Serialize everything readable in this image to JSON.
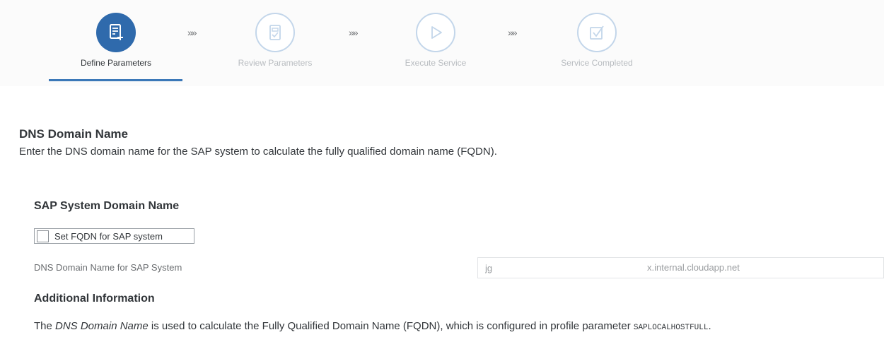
{
  "wizard": {
    "steps": [
      {
        "label": "Define Parameters",
        "state": "active",
        "icon": "form-add-icon"
      },
      {
        "label": "Review Parameters",
        "state": "inactive",
        "icon": "document-check-icon"
      },
      {
        "label": "Execute Service",
        "state": "inactive",
        "icon": "play-icon"
      },
      {
        "label": "Service Completed",
        "state": "inactive",
        "icon": "checkbox-check-icon"
      }
    ],
    "separator": "»»",
    "colors": {
      "active": "#2f6aac",
      "inactive_ring": "#c3d6ea",
      "underline": "#3b78b8"
    }
  },
  "section": {
    "title": "DNS Domain Name",
    "description": "Enter the DNS domain name for the SAP system to calculate the fully qualified domain name (FQDN)."
  },
  "form": {
    "group_title": "SAP System Domain Name",
    "checkbox": {
      "label": "Set FQDN for SAP system",
      "checked": false
    },
    "dns_field": {
      "label": "DNS Domain Name for SAP System",
      "value": "jg",
      "value_suffix": "x.internal.cloudapp.net"
    }
  },
  "additional": {
    "title": "Additional Information",
    "text_prefix": "The ",
    "text_em": "DNS Domain Name",
    "text_middle": " is used to calculate the Fully Qualified Domain Name (FQDN), which is configured in profile parameter ",
    "text_code": "SAPLOCALHOSTFULL",
    "text_end": "."
  }
}
